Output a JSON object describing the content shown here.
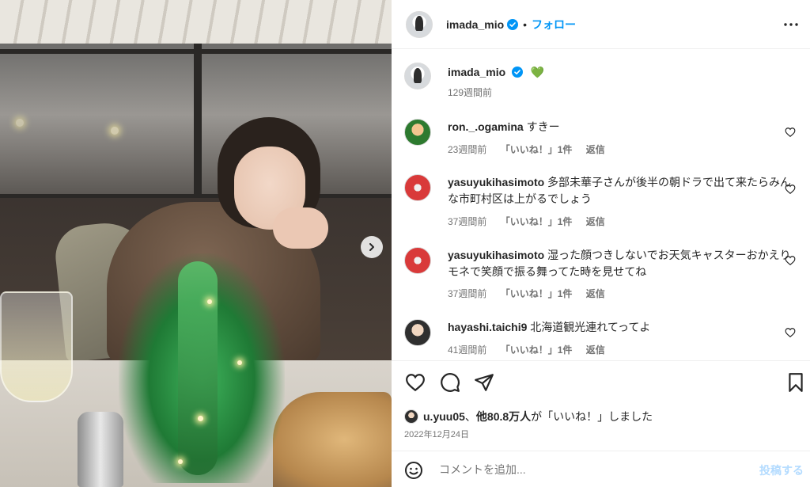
{
  "post": {
    "username": "imada_mio",
    "follow_label": "フォロー",
    "dot": "•"
  },
  "caption": {
    "username": "imada_mio",
    "emoji": "💚",
    "time": "129週間前"
  },
  "comments": [
    {
      "username": "ron._.ogamina",
      "text": "すきー",
      "time": "23週間前",
      "likes": "「いいね！」1件",
      "reply": "返信"
    },
    {
      "username": "yasuyukihasimoto",
      "text": "多部未華子さんが後半の朝ドラで出て来たらみんな市町村区は上がるでしょう",
      "time": "37週間前",
      "likes": "「いいね！」1件",
      "reply": "返信"
    },
    {
      "username": "yasuyukihasimoto",
      "text": "湿った顔つきしないでお天気キャスターおかえりモネで笑顔で振る舞ってた時を見せてね",
      "time": "37週間前",
      "likes": "「いいね！」1件",
      "reply": "返信"
    },
    {
      "username": "hayashi.taichi9",
      "text": "北海道観光連れてってよ",
      "time": "41週間前",
      "likes": "「いいね！」1件",
      "reply": "返信"
    }
  ],
  "likes_summary": {
    "user": "u.yuu05",
    "sep": "、",
    "others": "他80.8万人",
    "suffix": "が「いいね！」しました"
  },
  "date": "2022年12月24日",
  "add_comment": {
    "placeholder": "コメントを追加...",
    "post_label": "投稿する"
  },
  "colors": {
    "accent": "#0095f6",
    "verified": "#0095f6",
    "muted": "#737373",
    "post_disabled": "#b3dbff"
  },
  "icons": [
    "verified-badge-icon",
    "more-options-icon",
    "heart-icon",
    "comment-icon",
    "share-icon",
    "save-icon",
    "emoji-icon",
    "chevron-right-icon"
  ]
}
